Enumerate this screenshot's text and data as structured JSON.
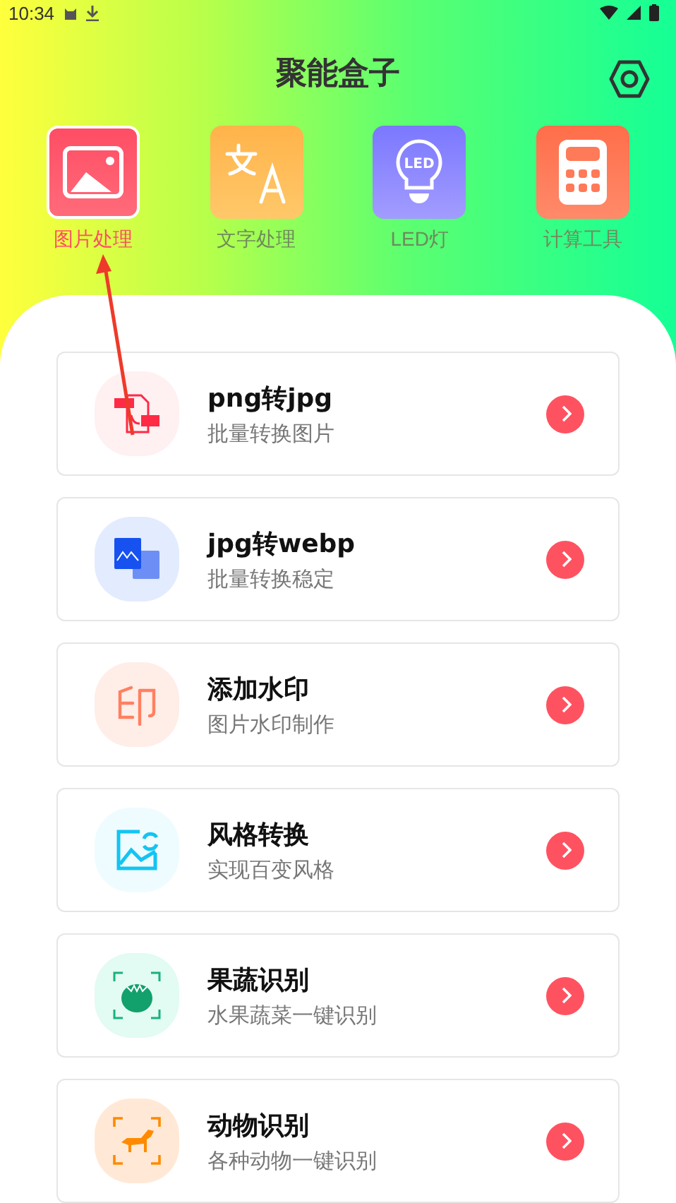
{
  "status_bar": {
    "time": "10:34"
  },
  "header": {
    "title": "聚能盒子"
  },
  "categories": [
    {
      "kind": "image",
      "label": "图片处理",
      "selected": true
    },
    {
      "kind": "translate",
      "label": "文字处理",
      "selected": false
    },
    {
      "kind": "led",
      "label": "LED灯",
      "icon_text": "LED",
      "selected": false
    },
    {
      "kind": "calculator",
      "label": "计算工具",
      "selected": false
    }
  ],
  "tools": [
    {
      "kind": "png",
      "title": "png转jpg",
      "subtitle": "批量转换图片"
    },
    {
      "kind": "webp",
      "title": "jpg转webp",
      "subtitle": "批量转换稳定"
    },
    {
      "kind": "stamp",
      "title": "添加水印",
      "subtitle": "图片水印制作"
    },
    {
      "kind": "style",
      "title": "风格转换",
      "subtitle": "实现百变风格"
    },
    {
      "kind": "fruit",
      "title": "果蔬识别",
      "subtitle": "水果蔬菜一键识别"
    },
    {
      "kind": "animal",
      "title": "动物识别",
      "subtitle": "各种动物一键识别"
    }
  ]
}
